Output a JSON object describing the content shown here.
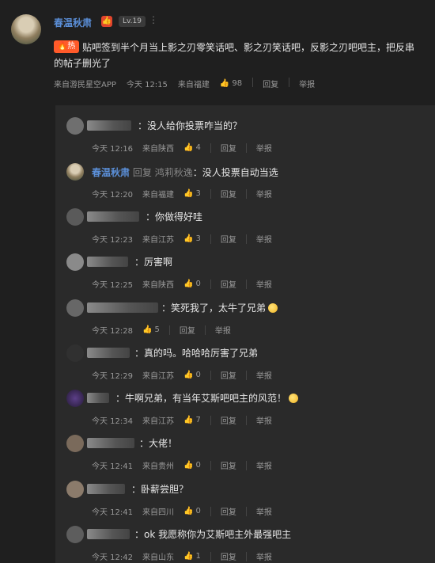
{
  "post": {
    "username": "春温秋肃",
    "level": "Lv.19",
    "more": "⋮",
    "hot_label": "热",
    "text": "贴吧签到半个月当上影之刃零笑话吧、影之刃笑话吧，反影之刃吧吧主，把反串的帖子删光了",
    "meta": {
      "source": "来自游民星空APP",
      "time": "今天 12:15",
      "location": "来自福建",
      "likes": "98",
      "reply": "回复",
      "report": "举报"
    }
  },
  "comments": [
    {
      "text": "：没人给你投票咋当的？",
      "time": "今天 12:16",
      "location": "来自陕西",
      "likes": "4",
      "reply": "回复",
      "report": "举报"
    },
    {
      "username": "春温秋肃",
      "reply_word": "回复",
      "reply_to": "鸿莉秋逸",
      "text": "：没人投票自动当选",
      "time": "今天 12:20",
      "location": "来自福建",
      "likes": "3",
      "reply": "回复",
      "report": "举报"
    },
    {
      "text": "：你做得好哇",
      "time": "今天 12:23",
      "location": "来自江苏",
      "likes": "3",
      "reply": "回复",
      "report": "举报"
    },
    {
      "text": "：厉害啊",
      "time": "今天 12:25",
      "location": "来自陕西",
      "likes": "0",
      "reply": "回复",
      "report": "举报"
    },
    {
      "text": "：笑死我了，太牛了兄弟",
      "time": "今天 12:28",
      "likes": "5",
      "reply": "回复",
      "report": "举报"
    },
    {
      "text": "：真的吗。哈哈哈厉害了兄弟",
      "time": "今天 12:29",
      "location": "来自江苏",
      "likes": "0",
      "reply": "回复",
      "report": "举报"
    },
    {
      "text": "：牛啊兄弟，有当年艾斯吧吧主的风范！",
      "time": "今天 12:34",
      "location": "来自江苏",
      "likes": "7",
      "reply": "回复",
      "report": "举报"
    },
    {
      "text": "：大佬！",
      "time": "今天 12:41",
      "location": "来自贵州",
      "likes": "0",
      "reply": "回复",
      "report": "举报"
    },
    {
      "text": "：卧薪尝胆？",
      "time": "今天 12:41",
      "location": "来自四川",
      "likes": "0",
      "reply": "回复",
      "report": "举报"
    },
    {
      "text": "：ok 我愿称你为艾斯吧主外最强吧主",
      "time": "今天 12:42",
      "location": "来自山东",
      "likes": "1",
      "reply": "回复",
      "report": "举报"
    }
  ]
}
